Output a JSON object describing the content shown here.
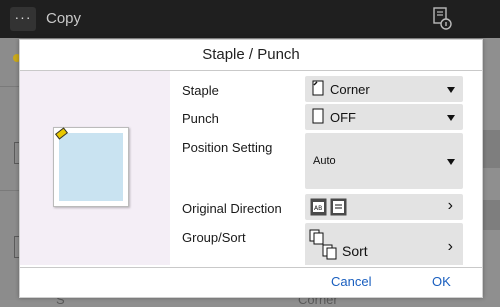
{
  "app": {
    "title": "Copy",
    "menu_label": "···",
    "top_icon": "job-status-icon"
  },
  "background": {
    "bottom_value": "Corner",
    "bottom_left": "S"
  },
  "dialog": {
    "title": "Staple / Punch",
    "rows": {
      "staple": {
        "label": "Staple",
        "value": "Corner",
        "icon": "staple-corner-icon"
      },
      "punch": {
        "label": "Punch",
        "value": "OFF",
        "icon": "punch-off-icon"
      },
      "position": {
        "label": "Position  Setting",
        "value": "Auto"
      },
      "direction": {
        "label": "Original  Direction",
        "icons": [
          "portrait-ab-icon",
          "landscape-ab-icon"
        ]
      },
      "group_sort": {
        "label": "Group/Sort",
        "value": "Sort",
        "icon": "sort-icon"
      }
    },
    "cancel_label": "Cancel",
    "ok_label": "OK"
  },
  "colors": {
    "accent": "#1a5fbf",
    "staple_mark": "#e8c800",
    "paper": "#c9e3f1",
    "preview_bg": "#f4eef6"
  }
}
